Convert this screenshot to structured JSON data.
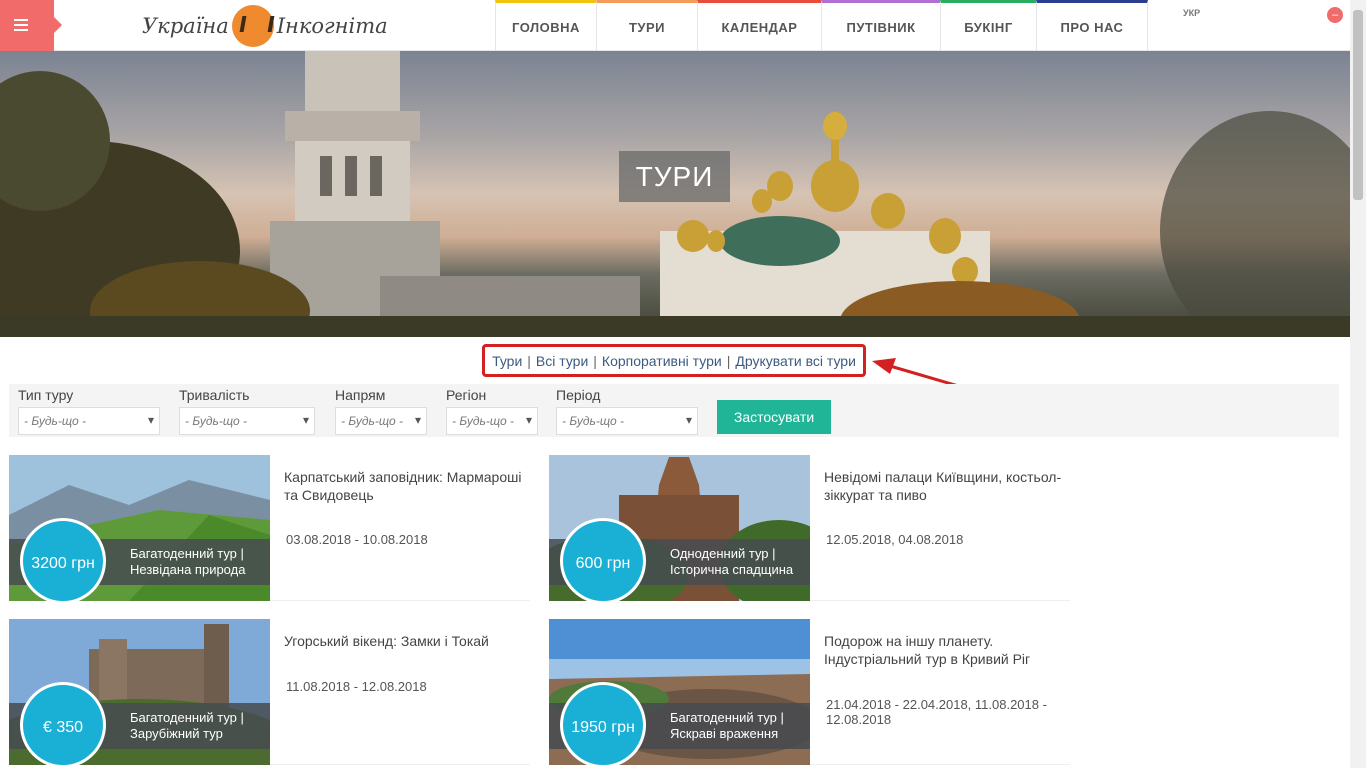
{
  "header": {
    "logo_left": "Україна",
    "logo_right": "Інкогніта",
    "nav": [
      {
        "label": "ГОЛОВНА",
        "color": "#f1c40f"
      },
      {
        "label": "ТУРИ",
        "color": "#f39c5a"
      },
      {
        "label": "КАЛЕНДАР",
        "color": "#e74c3c"
      },
      {
        "label": "ПУТІВНИК",
        "color": "#b16fd4"
      },
      {
        "label": "БУКІНГ",
        "color": "#27ae60"
      },
      {
        "label": "ПРО НАС",
        "color": "#2c3e90"
      }
    ],
    "lang": "УКР"
  },
  "hero": {
    "title": "ТУРИ"
  },
  "categories": [
    "Тури",
    "Всі тури",
    "Корпоративні тури",
    "Друкувати всі тури"
  ],
  "filters": {
    "fields": [
      {
        "label": "Тип туру",
        "value": "- Будь-що -"
      },
      {
        "label": "Тривалість",
        "value": "- Будь-що -"
      },
      {
        "label": "Напрям",
        "value": "- Будь-що -"
      },
      {
        "label": "Регіон",
        "value": "- Будь-що -"
      },
      {
        "label": "Період",
        "value": "- Будь-що -"
      }
    ],
    "apply_label": "Застосувати"
  },
  "cards": [
    {
      "price": "3200 грн",
      "tag_line1": "Багатоденний тур |",
      "tag_line2": "Незвідана природа",
      "title": "Карпатський заповідник: Мармароші та Свидовець",
      "dates": "03.08.2018 - 10.08.2018"
    },
    {
      "price": "600 грн",
      "tag_line1": "Одноденний тур |",
      "tag_line2": "Історична спадщина",
      "title": "Невідомі палаци Київщини, костьол-зіккурат та пиво",
      "dates": "12.05.2018, 04.08.2018"
    },
    {
      "price": "€ 350",
      "tag_line1": "Багатоденний тур |",
      "tag_line2": "Зарубіжний тур",
      "title": "Угорський вікенд: Замки і Токай",
      "dates": "11.08.2018 - 12.08.2018"
    },
    {
      "price": "1950 грн",
      "tag_line1": "Багатоденний тур |",
      "tag_line2": "Яскраві враження",
      "title": "Подорож на іншу планету. Індустріальний тур в Кривий Ріг",
      "dates": "21.04.2018 - 22.04.2018, 11.08.2018 - 12.08.2018"
    }
  ]
}
